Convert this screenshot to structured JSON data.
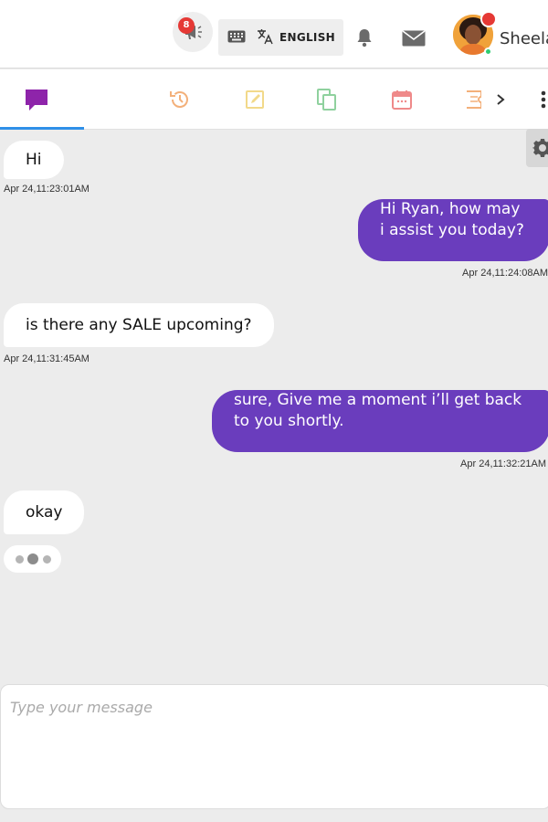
{
  "header": {
    "notification_count": "8",
    "language_label": "ENGLISH",
    "user_name": "Sheela"
  },
  "tabs": [
    {
      "name": "chat",
      "icon": "chat-icon",
      "color": "#8e24aa",
      "active": true
    },
    {
      "name": "history",
      "icon": "history-icon",
      "color": "#f3b07a"
    },
    {
      "name": "notes",
      "icon": "notes-icon",
      "color": "#f2d98a"
    },
    {
      "name": "copy",
      "icon": "copy-icon",
      "color": "#8fd19e"
    },
    {
      "name": "calendar",
      "icon": "calendar-icon",
      "color": "#ef8a8a"
    },
    {
      "name": "ticket",
      "icon": "ticket-icon",
      "color": "#f3b07a"
    }
  ],
  "messages": [
    {
      "direction": "in",
      "text": "Hi",
      "timestamp": "Apr 24,11:23:01AM"
    },
    {
      "direction": "out",
      "text": "Hi Ryan, how may i assist you today?",
      "timestamp": "Apr 24,11:24:08AM"
    },
    {
      "direction": "in",
      "text": "is there any SALE upcoming?",
      "timestamp": "Apr 24,11:31:45AM"
    },
    {
      "direction": "out",
      "text": "sure, Give me a moment i’ll get back to you shortly.",
      "timestamp": "Apr 24,11:32:21AM"
    },
    {
      "direction": "in",
      "text": "okay",
      "timestamp": ""
    }
  ],
  "composer": {
    "placeholder": "Type your message",
    "value": ""
  },
  "colors": {
    "accent": "#6a3dbd",
    "active_tab_underline": "#2f8fe8",
    "badge": "#e53935"
  }
}
